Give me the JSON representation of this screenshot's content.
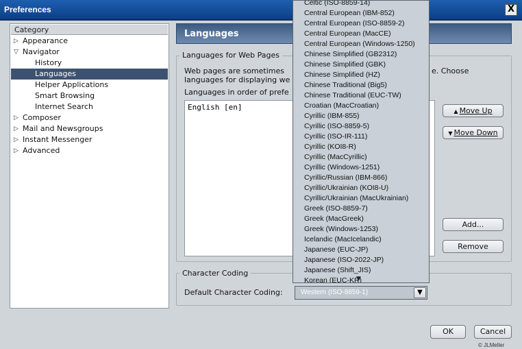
{
  "window": {
    "title": "Preferences",
    "close_label": "X"
  },
  "sidebar": {
    "header": "Category",
    "items": [
      {
        "label": "Appearance"
      },
      {
        "label": "Navigator"
      },
      {
        "label": "History"
      },
      {
        "label": "Languages"
      },
      {
        "label": "Helper Applications"
      },
      {
        "label": "Smart Browsing"
      },
      {
        "label": "Internet Search"
      },
      {
        "label": "Composer"
      },
      {
        "label": "Mail and Newsgroups"
      },
      {
        "label": "Instant Messenger"
      },
      {
        "label": "Advanced"
      }
    ]
  },
  "panel": {
    "title": "Languages",
    "web_pages_group": {
      "legend": "Languages for Web Pages",
      "desc_line1_left": "Web pages are sometimes",
      "desc_line1_right": "e.  Choose",
      "desc_line2": "languages for displaying we",
      "list_label": "Languages in order of prefe",
      "languages": [
        "English  [en]"
      ],
      "move_up": "Move Up",
      "move_down": "Move Down",
      "add": "Add...",
      "remove": "Remove"
    },
    "coding_group": {
      "legend": "Character Coding",
      "default_label": "Default Character Coding:",
      "selected_value": "Western (ISO-8859-1)"
    }
  },
  "dropdown": {
    "options": [
      "Celtic (ISO-8859-14)",
      "Central European (IBM-852)",
      "Central European (ISO-8859-2)",
      "Central European (MacCE)",
      "Central European (Windows-1250)",
      "Chinese Simplified (GB2312)",
      "Chinese Simplified (GBK)",
      "Chinese Simplified (HZ)",
      "Chinese Traditional (Big5)",
      "Chinese Traditional (EUC-TW)",
      "Croatian (MacCroatian)",
      "Cyrillic (IBM-855)",
      "Cyrillic (ISO-8859-5)",
      "Cyrillic (ISO-IR-111)",
      "Cyrillic (KOI8-R)",
      "Cyrillic (MacCyrillic)",
      "Cyrillic (Windows-1251)",
      "Cyrillic/Russian (IBM-866)",
      "Cyrillic/Ukrainian (KOI8-U)",
      "Cyrillic/Ukrainian (MacUkrainian)",
      "Greek (ISO-8859-7)",
      "Greek (MacGreek)",
      "Greek (Windows-1253)",
      "Icelandic (MacIcelandic)",
      "Japanese (EUC-JP)",
      "Japanese (ISO-2022-JP)",
      "Japanese (Shift_JIS)",
      "Korean (EUC-KR)"
    ]
  },
  "footer": {
    "ok": "OK",
    "cancel": "Cancel",
    "copyright": "© JLMeller"
  }
}
